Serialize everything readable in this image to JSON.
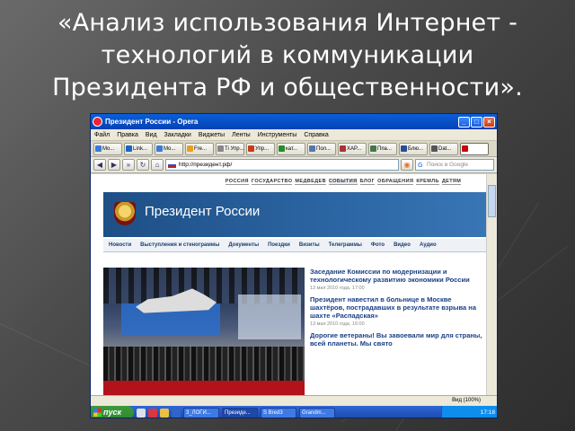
{
  "slide": {
    "title_line1": "«Анализ использования Интернет -",
    "title_line2": "технологий в коммуникации",
    "title_line3": "Президента РФ и общественности»."
  },
  "browser": {
    "window_title": "Президент России - Opera",
    "window_buttons": [
      "_",
      "□",
      "×"
    ],
    "menu": [
      "Файл",
      "Правка",
      "Вид",
      "Закладки",
      "Виджеты",
      "Ленты",
      "Инструменты",
      "Справка"
    ],
    "tabs": [
      {
        "label": "Mo...",
        "color": "#3a7bd5"
      },
      {
        "label": "Link...",
        "color": "#1a66c2"
      },
      {
        "label": "Mo...",
        "color": "#3a7bd5"
      },
      {
        "label": "Fre...",
        "color": "#e8a020"
      },
      {
        "label": "Ti Упр...",
        "color": "#888"
      },
      {
        "label": "Упр...",
        "color": "#c83c1a"
      },
      {
        "label": "кат...",
        "color": "#2a8a2a"
      },
      {
        "label": "Пол...",
        "color": "#5577aa"
      },
      {
        "label": "XAP...",
        "color": "#aa3333"
      },
      {
        "label": "Ппа...",
        "color": "#447744"
      },
      {
        "label": "Блю...",
        "color": "#2a4a9a"
      },
      {
        "label": "Dat...",
        "color": "#555"
      },
      {
        "label": "",
        "color": "#c00"
      }
    ],
    "address": "http://президент.рф/",
    "search_placeholder": "Поиск в Google",
    "status_zoom": "Вид (100%)"
  },
  "site": {
    "top_nav": [
      "РОССИЯ",
      "ГОСУДАРСТВО",
      "МЕДВЕДЕВ",
      "СОБЫТИЯ",
      "БЛОГ",
      "ОБРАЩЕНИЯ",
      "КРЕМЛЬ",
      "ДЕТЯМ"
    ],
    "top_nav_active": "СОБЫТИЯ",
    "header_title": "Президент России",
    "sections": [
      "Новости",
      "Выступления и стенограммы",
      "Документы",
      "Поездки",
      "Визиты",
      "Телеграммы",
      "Фото",
      "Видео",
      "Аудио"
    ],
    "news": [
      {
        "headline": "Заседание Комиссии по модернизации и технологическому развитию экономики России",
        "date": "13 мая 2010 года, 17:00"
      },
      {
        "headline": "Президент навестил в больнице в Москве шахтёров, пострадавших в результате взрыва на шахте «Распадская»",
        "date": "13 мая 2010 года, 16:00"
      },
      {
        "headline": "Дорогие ветераны! Вы завоевали мир для страны, всей планеты. Мы свято",
        "date": ""
      }
    ]
  },
  "taskbar": {
    "start_label": "пуск",
    "tasks": [
      "3_ЛОГИ...",
      "Президе...",
      "S Bred3",
      "Grandm..."
    ],
    "time": "17:18"
  }
}
